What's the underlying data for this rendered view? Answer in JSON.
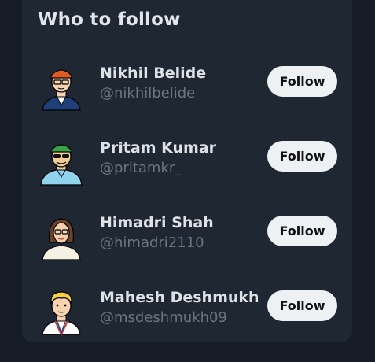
{
  "widget": {
    "title": "Who to follow",
    "users": [
      {
        "name": "Nikhil Belide",
        "handle": "@nikhilbelide",
        "button_label": "Follow",
        "avatar_icon": "cartoon-avatar-red-hat-icon"
      },
      {
        "name": "Pritam Kumar",
        "handle": "@pritamkr_",
        "button_label": "Follow",
        "avatar_icon": "cartoon-avatar-green-cap-icon"
      },
      {
        "name": "Himadri Shah",
        "handle": "@himadri2110",
        "button_label": "Follow",
        "avatar_icon": "cartoon-avatar-brown-hair-icon"
      },
      {
        "name": "Mahesh Deshmukh",
        "handle": "@msdeshmukh09",
        "button_label": "Follow",
        "avatar_icon": "cartoon-avatar-blond-hair-icon"
      }
    ]
  },
  "colors": {
    "page_background": "#151c27",
    "card_background": "#1f2733",
    "button_background": "#eef1f4",
    "name_text": "#dde1e6",
    "handle_text": "#6c7480"
  }
}
